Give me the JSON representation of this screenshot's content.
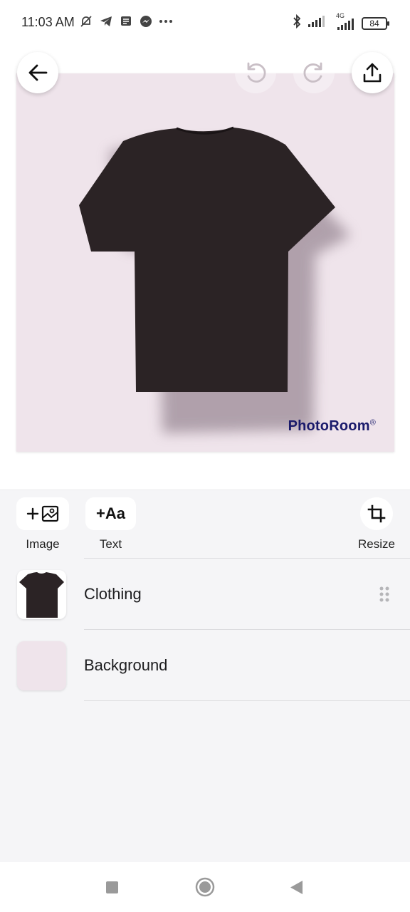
{
  "status_bar": {
    "time": "11:03 AM",
    "network_label": "4G",
    "battery": "84",
    "icons": [
      "mute-icon",
      "telegram-icon",
      "message-icon",
      "messenger-icon",
      "more-dots-icon",
      "bluetooth-icon",
      "signal-icon",
      "signal-4g-icon",
      "battery-icon"
    ]
  },
  "toolbar": {
    "back_icon": "arrow-left-icon",
    "undo_icon": "undo-icon",
    "redo_icon": "redo-icon",
    "share_icon": "share-icon"
  },
  "canvas": {
    "background_color": "#efe4eb",
    "watermark": "PhotoRoom",
    "watermark_mark": "®"
  },
  "tools": {
    "image_label": "Image",
    "text_label": "Text",
    "text_glyph": "+Aa",
    "resize_label": "Resize"
  },
  "layers": [
    {
      "label": "Clothing",
      "thumb": "tshirt"
    },
    {
      "label": "Background",
      "thumb": "color"
    }
  ],
  "nav": {
    "recents_icon": "square-icon",
    "home_icon": "circle-icon",
    "back_icon": "triangle-back-icon"
  }
}
